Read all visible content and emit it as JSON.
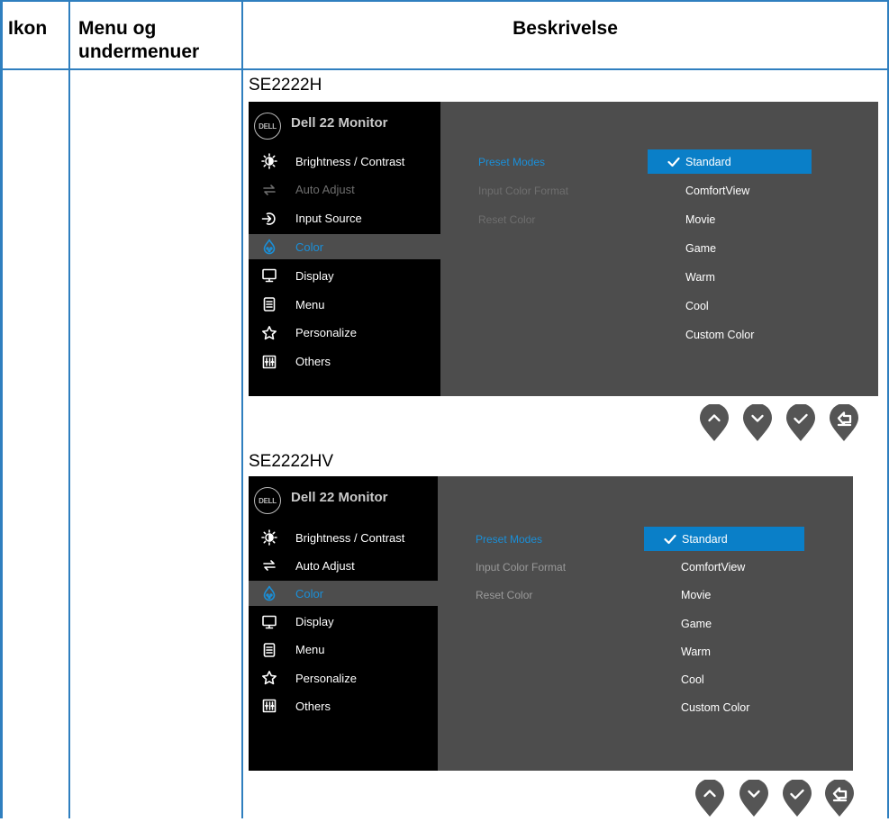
{
  "table": {
    "headers": {
      "icon": "Ikon",
      "menu": "Menu og undermenuer",
      "description": "Beskrivelse"
    }
  },
  "panels": [
    {
      "model": "SE2222H",
      "osd": {
        "logo": "DELL",
        "title": "Dell 22 Monitor",
        "menu": [
          {
            "label": "Brightness / Contrast",
            "icon": "brightness-icon",
            "state": "normal"
          },
          {
            "label": "Auto Adjust",
            "icon": "auto-adjust-icon",
            "state": "disabled"
          },
          {
            "label": "Input Source",
            "icon": "input-source-icon",
            "state": "normal"
          },
          {
            "label": "Color",
            "icon": "color-icon",
            "state": "selected"
          },
          {
            "label": "Display",
            "icon": "display-icon",
            "state": "normal"
          },
          {
            "label": "Menu",
            "icon": "menu-icon",
            "state": "normal"
          },
          {
            "label": "Personalize",
            "icon": "star-icon",
            "state": "normal"
          },
          {
            "label": "Others",
            "icon": "others-icon",
            "state": "normal"
          }
        ],
        "submenu": [
          {
            "label": "Preset Modes",
            "state": "active"
          },
          {
            "label": "Input Color Format",
            "state": "disabled"
          },
          {
            "label": "Reset Color",
            "state": "disabled"
          }
        ],
        "options": [
          "Standard",
          "ComfortView",
          "Movie",
          "Game",
          "Warm",
          "Cool",
          "Custom Color"
        ],
        "selected_option": "Standard"
      },
      "buttons": [
        "up-button",
        "down-button",
        "confirm-button",
        "back-button"
      ]
    },
    {
      "model": "SE2222HV",
      "osd": {
        "logo": "DELL",
        "title": "Dell 22 Monitor",
        "menu": [
          {
            "label": "Brightness / Contrast",
            "icon": "brightness-icon",
            "state": "normal"
          },
          {
            "label": "Auto Adjust",
            "icon": "auto-adjust-icon",
            "state": "normal"
          },
          {
            "label": "Color",
            "icon": "color-icon",
            "state": "selected"
          },
          {
            "label": "Display",
            "icon": "display-icon",
            "state": "normal"
          },
          {
            "label": "Menu",
            "icon": "menu-icon",
            "state": "normal"
          },
          {
            "label": "Personalize",
            "icon": "star-icon",
            "state": "normal"
          },
          {
            "label": "Others",
            "icon": "others-icon",
            "state": "normal"
          }
        ],
        "submenu": [
          {
            "label": "Preset Modes",
            "state": "active"
          },
          {
            "label": "Input Color Format",
            "state": "normal"
          },
          {
            "label": "Reset Color",
            "state": "normal"
          }
        ],
        "options": [
          "Standard",
          "ComfortView",
          "Movie",
          "Game",
          "Warm",
          "Cool",
          "Custom Color"
        ],
        "selected_option": "Standard"
      },
      "buttons": [
        "up-button",
        "down-button",
        "confirm-button",
        "back-button"
      ]
    }
  ],
  "colors": {
    "border": "#2f7fbf",
    "osd_background": "#4d4d4d",
    "osd_sidebar": "#000000",
    "accent_blue": "#1a8fd8",
    "selected_option_bg": "#0a7fc8",
    "nav_button": "#555555"
  }
}
